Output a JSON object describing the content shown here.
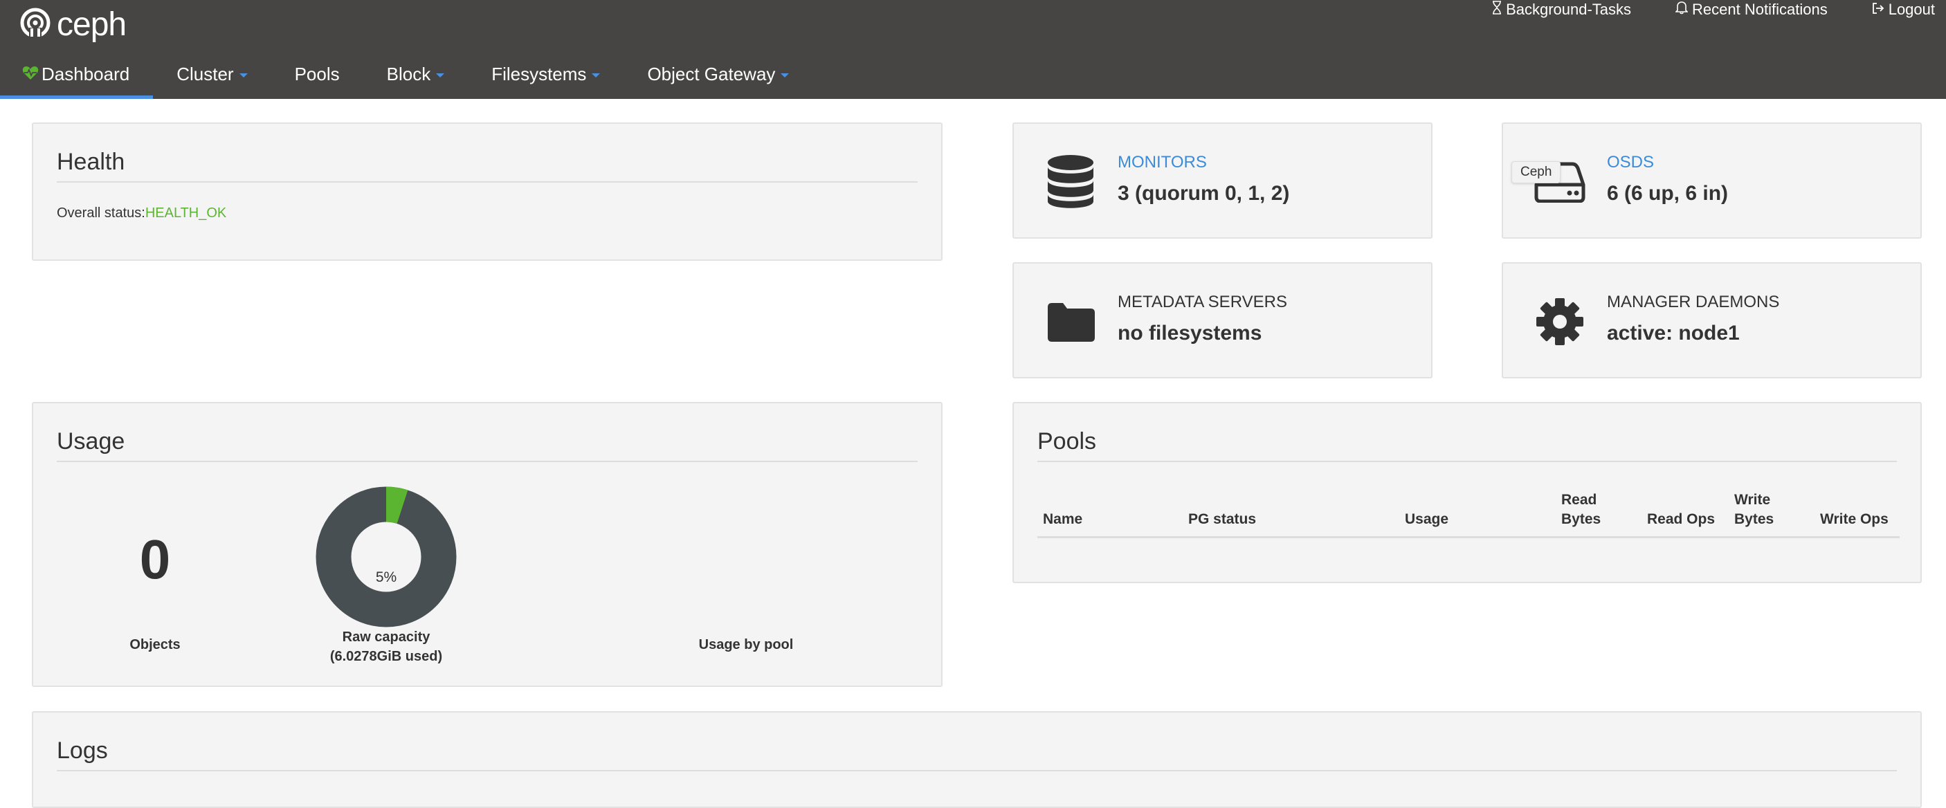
{
  "brand": {
    "name": "ceph"
  },
  "utility": {
    "background_tasks": "Background-Tasks",
    "recent_notifications": "Recent Notifications",
    "logout": "Logout"
  },
  "nav": {
    "items": [
      {
        "label": "Dashboard",
        "active": true,
        "dropdown": false,
        "icon": "heartbeat-icon"
      },
      {
        "label": "Cluster",
        "active": false,
        "dropdown": true
      },
      {
        "label": "Pools",
        "active": false,
        "dropdown": false
      },
      {
        "label": "Block",
        "active": false,
        "dropdown": true
      },
      {
        "label": "Filesystems",
        "active": false,
        "dropdown": true
      },
      {
        "label": "Object Gateway",
        "active": false,
        "dropdown": true
      }
    ]
  },
  "health": {
    "title": "Health",
    "status_label": "Overall status:",
    "status_value": "HEALTH_OK"
  },
  "monitors": {
    "label": "MONITORS",
    "value": "3 (quorum 0, 1, 2)",
    "icon": "database-icon"
  },
  "osds": {
    "label": "OSDS",
    "value": "6 (6 up, 6 in)",
    "icon": "hdd-icon",
    "tooltip": "Ceph"
  },
  "metadata_servers": {
    "label": "METADATA SERVERS",
    "value": "no filesystems",
    "icon": "folder-icon"
  },
  "manager_daemons": {
    "label": "MANAGER DAEMONS",
    "value": "active: node1",
    "icon": "gear-icon"
  },
  "usage": {
    "title": "Usage",
    "objects_value": "0",
    "objects_label": "Objects",
    "raw_capacity_percent_label": "5%",
    "raw_capacity_fraction": 0.05,
    "raw_capacity_label_line1": "Raw capacity",
    "raw_capacity_label_line2": "(6.0278GiB used)",
    "usage_by_pool_label": "Usage by pool"
  },
  "pools": {
    "title": "Pools",
    "columns": {
      "name": "Name",
      "pg_status": "PG status",
      "usage": "Usage",
      "read_bytes_1": "Read",
      "read_bytes_2": "Bytes",
      "read_ops": "Read Ops",
      "write_bytes_1": "Write",
      "write_bytes_2": "Bytes",
      "write_ops": "Write Ops"
    }
  },
  "logs": {
    "title": "Logs"
  },
  "colors": {
    "navbar": "#474544",
    "accent": "#4a90e2",
    "ok": "#5cb531",
    "donut_used": "#5cb531",
    "donut_free": "#474f52"
  }
}
